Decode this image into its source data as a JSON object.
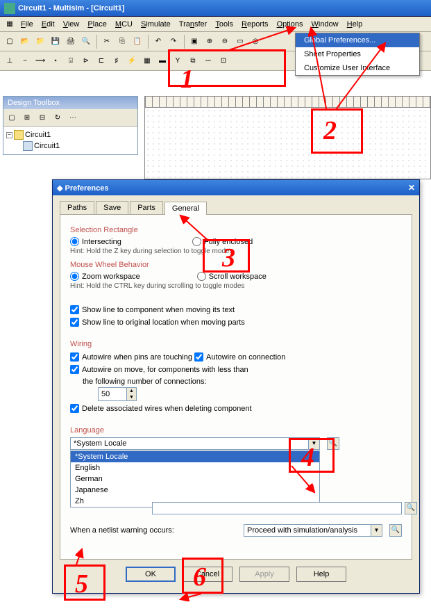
{
  "titlebar": "Circuit1 - Multisim - [Circuit1]",
  "menu": [
    "File",
    "Edit",
    "View",
    "Place",
    "MCU",
    "Simulate",
    "Transfer",
    "Tools",
    "Reports",
    "Options",
    "Window",
    "Help"
  ],
  "dropdown": {
    "items": [
      "Global Preferences...",
      "Sheet Properties",
      "Customize User Interface"
    ],
    "selected": 0
  },
  "toolbox": {
    "title": "Design Toolbox",
    "root": "Circuit1",
    "child": "Circuit1"
  },
  "dialog": {
    "title": "Preferences",
    "tabs": [
      "Paths",
      "Save",
      "Parts",
      "General"
    ],
    "activeTab": 3,
    "selRect": {
      "title": "Selection Rectangle",
      "opt1": "Intersecting",
      "opt2": "Fully enclosed",
      "hint": "Hint: Hold the Z key during selection to toggle modes"
    },
    "wheel": {
      "title": "Mouse Wheel Behavior",
      "opt1": "Zoom workspace",
      "opt2": "Scroll workspace",
      "hint": "Hint: Hold the CTRL key during scrolling to toggle modes"
    },
    "chk_line_text": "Show line to component when moving its text",
    "chk_line_orig": "Show line to original location when moving parts",
    "wiring": {
      "title": "Wiring",
      "c1": "Autowire when pins are touching",
      "c2": "Autowire on connection",
      "c3": "Autowire on move, for components with less than",
      "c3b": "the following number of connections:",
      "spin": "50",
      "c4": "Delete associated wires when deleting component"
    },
    "lang": {
      "title": "Language",
      "value": "*System Locale",
      "options": [
        "*System Locale",
        "English",
        "German",
        "Japanese",
        "Zh"
      ]
    },
    "netlist": {
      "label": "When a netlist warning occurs:",
      "value": "Proceed with simulation/analysis"
    },
    "buttons": {
      "ok": "OK",
      "cancel": "Cancel",
      "apply": "Apply",
      "help": "Help"
    }
  },
  "annotations": {
    "n1": "1",
    "n2": "2",
    "n3": "3",
    "n4": "4",
    "n5": "5",
    "n6": "6"
  }
}
